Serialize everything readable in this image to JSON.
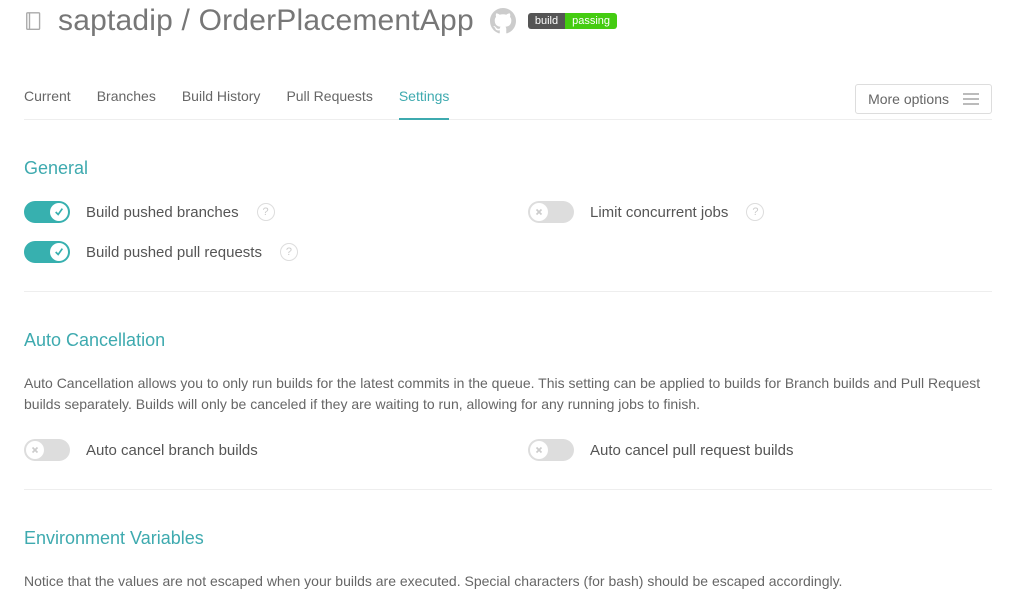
{
  "header": {
    "owner": "saptadip",
    "repo": "OrderPlacementApp",
    "title": "saptadip / OrderPlacementApp",
    "badge": {
      "left": "build",
      "right": "passing"
    }
  },
  "tabs": [
    "Current",
    "Branches",
    "Build History",
    "Pull Requests",
    "Settings"
  ],
  "active_tab": "Settings",
  "more_label": "More options",
  "sections": {
    "general": {
      "title": "General",
      "toggles": [
        {
          "label": "Build pushed branches",
          "on": true,
          "help": true
        },
        {
          "label": "Limit concurrent jobs",
          "on": false,
          "help": true
        },
        {
          "label": "Build pushed pull requests",
          "on": true,
          "help": true
        }
      ]
    },
    "auto_cancel": {
      "title": "Auto Cancellation",
      "desc": "Auto Cancellation allows you to only run builds for the latest commits in the queue. This setting can be applied to builds for Branch builds and Pull Request builds separately. Builds will only be canceled if they are waiting to run, allowing for any running jobs to finish.",
      "toggles": [
        {
          "label": "Auto cancel branch builds",
          "on": false
        },
        {
          "label": "Auto cancel pull request builds",
          "on": false
        }
      ]
    },
    "env": {
      "title": "Environment Variables",
      "desc": "Notice that the values are not escaped when your builds are executed. Special characters (for bash) should be escaped accordingly."
    }
  }
}
